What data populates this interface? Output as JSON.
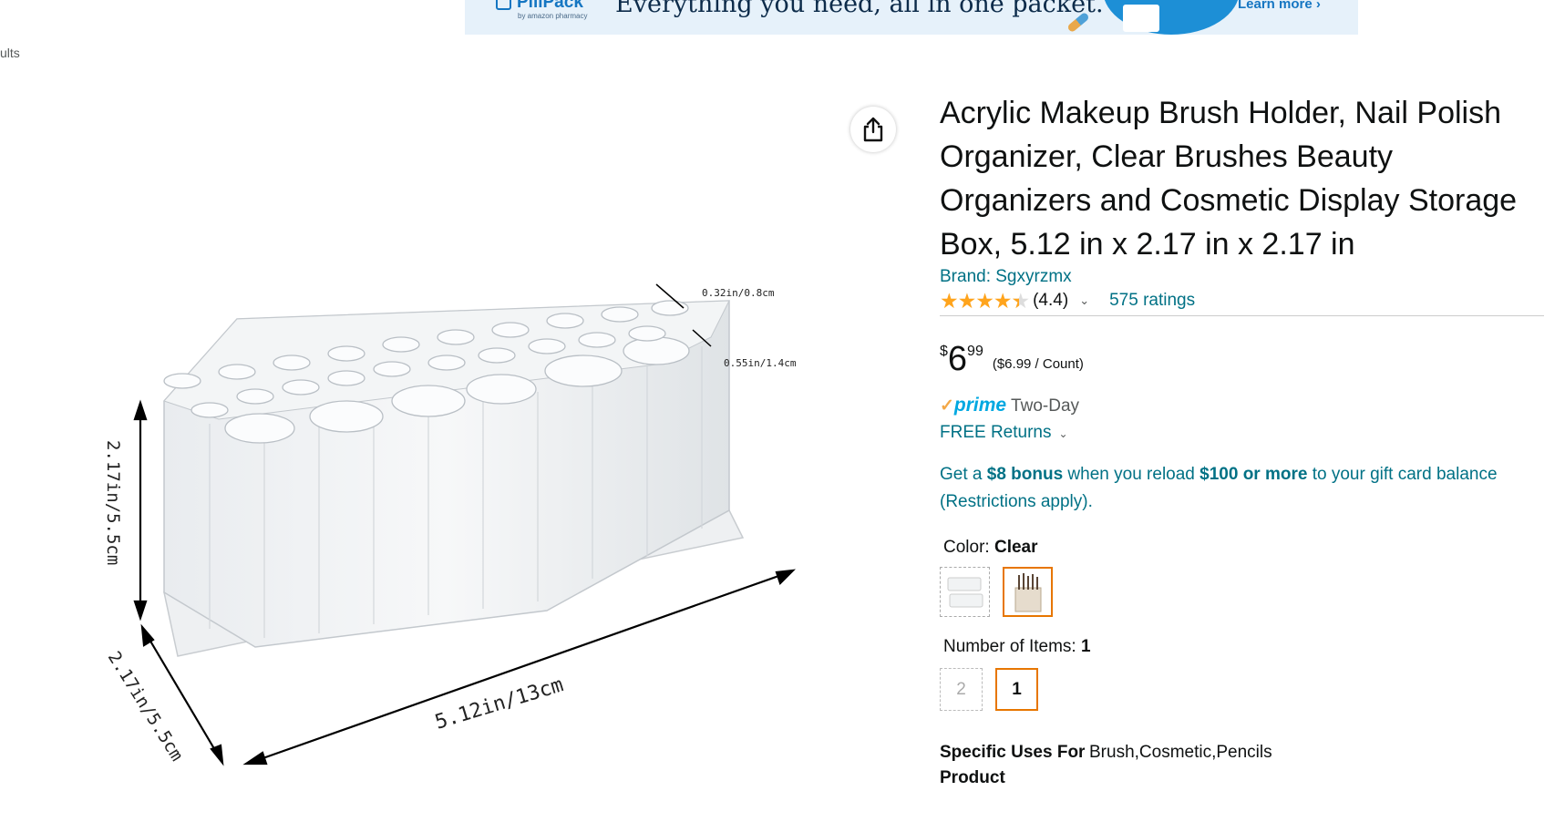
{
  "banner": {
    "logo": "PillPack",
    "logo_sub": "by amazon pharmacy",
    "tagline": "Everything you need, all in one packet.",
    "cta": "Learn more ›"
  },
  "breadcrumb": "ults",
  "image": {
    "dims": {
      "height": "2.17in/5.5cm",
      "depth": "2.17in/5.5cm",
      "width": "5.12in/13cm",
      "small_hole": "0.32in/0.8cm",
      "large_hole": "0.55in/1.4cm"
    }
  },
  "product": {
    "title": "Acrylic Makeup Brush Holder, Nail Polish Organizer, Clear Brushes Beauty Organizers and Cosmetic Display Storage Box, 5.12 in x 2.17 in x 2.17 in",
    "brand": "Brand: Sgxyrzmx",
    "rating_value": "(4.4)",
    "rating_stars": 4.4,
    "ratings_count": "575 ratings",
    "price": {
      "symbol": "$",
      "whole": "6",
      "fraction": "99",
      "unit_price": "($6.99 / Count)"
    },
    "prime_label": "prime",
    "prime_delivery": "Two-Day",
    "returns": "FREE Returns",
    "promo": {
      "p1": "Get a ",
      "b1": "$8 bonus",
      "p2": " when you reload ",
      "b2": "$100 or more",
      "p3": " to your gift card balance (Restrictions apply)."
    },
    "color_label": "Color: ",
    "color_value": "Clear",
    "items_label": "Number of Items: ",
    "items_value": "1",
    "item_options": [
      "2",
      "1"
    ],
    "spec_key": "Specific Uses For Product",
    "spec_value": "Brush,Cosmetic,Pencils"
  },
  "colors": {
    "link": "#007185",
    "star": "#ffa41c",
    "selected": "#e77600",
    "prime": "#00a8e1"
  }
}
